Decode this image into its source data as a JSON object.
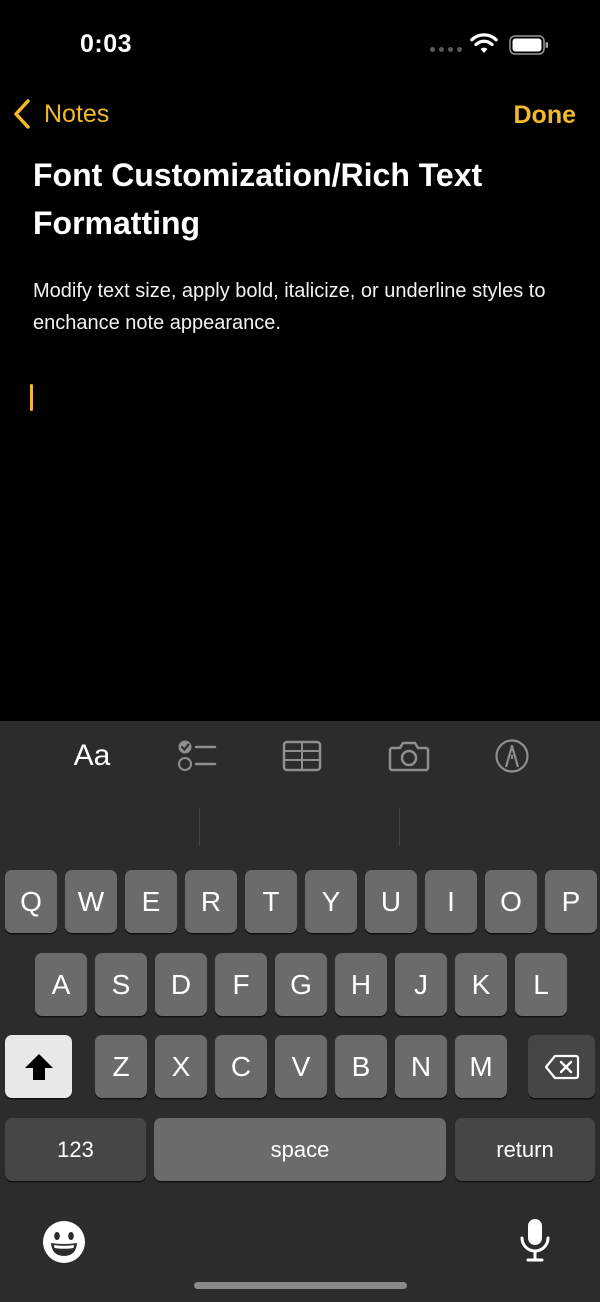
{
  "status_bar": {
    "time": "0:03"
  },
  "nav": {
    "back_label": "Notes",
    "done_label": "Done",
    "accent_color": "#f2b928"
  },
  "note": {
    "title": "Font Customization/Rich Text Formatting",
    "body": "Modify text size, apply bold, italicize, or underline styles to enchance note appearance."
  },
  "toolbar": {
    "format_label": "Aa",
    "icons": [
      "checklist-icon",
      "table-icon",
      "camera-icon",
      "markup-icon"
    ]
  },
  "keyboard": {
    "row1": [
      "Q",
      "W",
      "E",
      "R",
      "T",
      "Y",
      "U",
      "I",
      "O",
      "P"
    ],
    "row2": [
      "A",
      "S",
      "D",
      "F",
      "G",
      "H",
      "J",
      "K",
      "L"
    ],
    "row3": [
      "Z",
      "X",
      "C",
      "V",
      "B",
      "N",
      "M"
    ],
    "numbers_label": "123",
    "space_label": "space",
    "return_label": "return"
  }
}
